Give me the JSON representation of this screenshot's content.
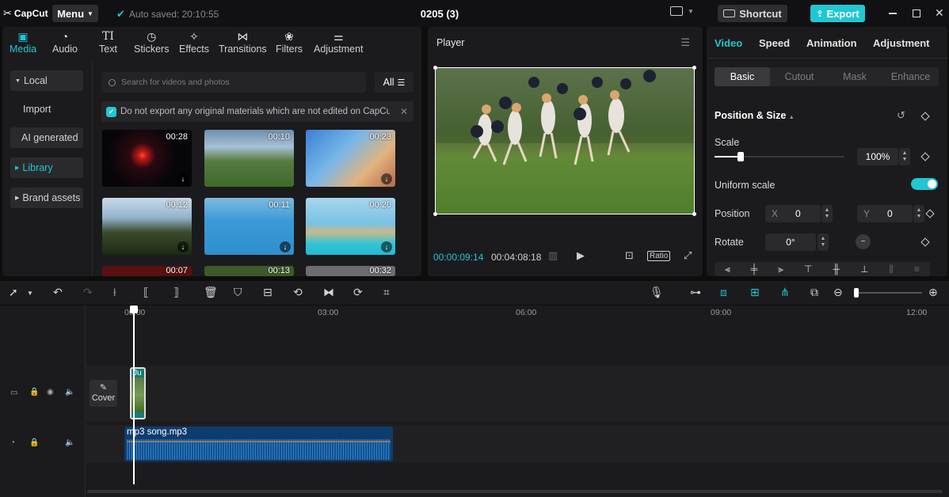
{
  "app": {
    "logo": "CapCut",
    "menu": "Menu",
    "autosave": "Auto saved: 20:10:55",
    "project": "0205 (3)",
    "shortcut": "Shortcut",
    "export": "Export"
  },
  "tool_tabs": [
    {
      "label": "Media",
      "icon": "media-icon"
    },
    {
      "label": "Audio",
      "icon": "audio-icon"
    },
    {
      "label": "Text",
      "icon": "text-icon"
    },
    {
      "label": "Stickers",
      "icon": "sticker-icon"
    },
    {
      "label": "Effects",
      "icon": "effects-icon"
    },
    {
      "label": "Transitions",
      "icon": "transition-icon"
    },
    {
      "label": "Filters",
      "icon": "filter-icon"
    },
    {
      "label": "Adjustment",
      "icon": "adjust-icon"
    }
  ],
  "side_nav": [
    "Local",
    "Import",
    "AI generated",
    "Library",
    "Brand assets"
  ],
  "search": {
    "placeholder": "Search for videos and photos",
    "filter": "All"
  },
  "notice": "Do not export any original materials which are not edited on CapCut",
  "thumbnails": [
    {
      "duration": "00:28"
    },
    {
      "duration": "00:10"
    },
    {
      "duration": "00:23"
    },
    {
      "duration": "00:12"
    },
    {
      "duration": "00:11"
    },
    {
      "duration": "00:20"
    },
    {
      "duration": "00:07"
    },
    {
      "duration": "00:13"
    },
    {
      "duration": "00:32"
    }
  ],
  "player": {
    "title": "Player",
    "current": "00:00:09:14",
    "total": "00:04:08:18",
    "ratio": "Ratio"
  },
  "right": {
    "tabs": [
      "Video",
      "Speed",
      "Animation",
      "Adjustment"
    ],
    "subtabs": [
      "Basic",
      "Cutout",
      "Mask",
      "Enhance"
    ],
    "section": "Position & Size",
    "scale_label": "Scale",
    "scale_value": "100%",
    "scale_fraction": 0.2,
    "uniform_label": "Uniform scale",
    "position_label": "Position",
    "x_label": "X",
    "x_value": "0",
    "y_label": "Y",
    "y_value": "0",
    "rotate_label": "Rotate",
    "rotate_value": "0°"
  },
  "ruler": [
    "00:00",
    "03:00",
    "06:00",
    "09:00",
    "12:00"
  ],
  "timeline": {
    "cover": "Cover",
    "video_clip": "Ju",
    "audio_clip": "mp3 song.mp3"
  },
  "colors": {
    "accent": "#20c7d3",
    "audio_clip": "#0f3c6e",
    "video_clip": "#1a7c78"
  }
}
